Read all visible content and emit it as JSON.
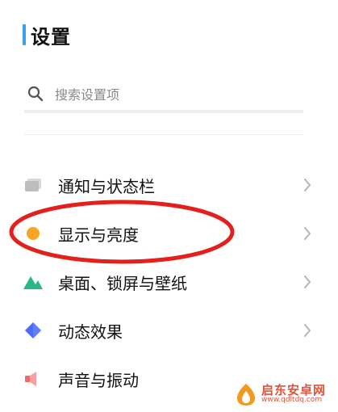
{
  "header": {
    "title": "设置",
    "accent_color": "#3aa0f0"
  },
  "search": {
    "placeholder": "搜索设置项",
    "icon": "search-icon"
  },
  "menu": {
    "items": [
      {
        "label": "通知与状态栏",
        "icon": "notification-icon"
      },
      {
        "label": "显示与亮度",
        "icon": "brightness-icon",
        "icon_color": "#f7a623"
      },
      {
        "label": "桌面、锁屏与壁纸",
        "icon": "wallpaper-icon",
        "icon_color": "#2bb58a"
      },
      {
        "label": "动态效果",
        "icon": "animation-icon",
        "icon_color": "#4a6cf7"
      },
      {
        "label": "声音与振动",
        "icon": "sound-icon",
        "icon_color": "#f06a6a"
      }
    ]
  },
  "annotation": {
    "highlight_color": "#e3201b"
  },
  "watermark": {
    "title": "启东安卓网",
    "url": "www.qdltdq.com"
  }
}
